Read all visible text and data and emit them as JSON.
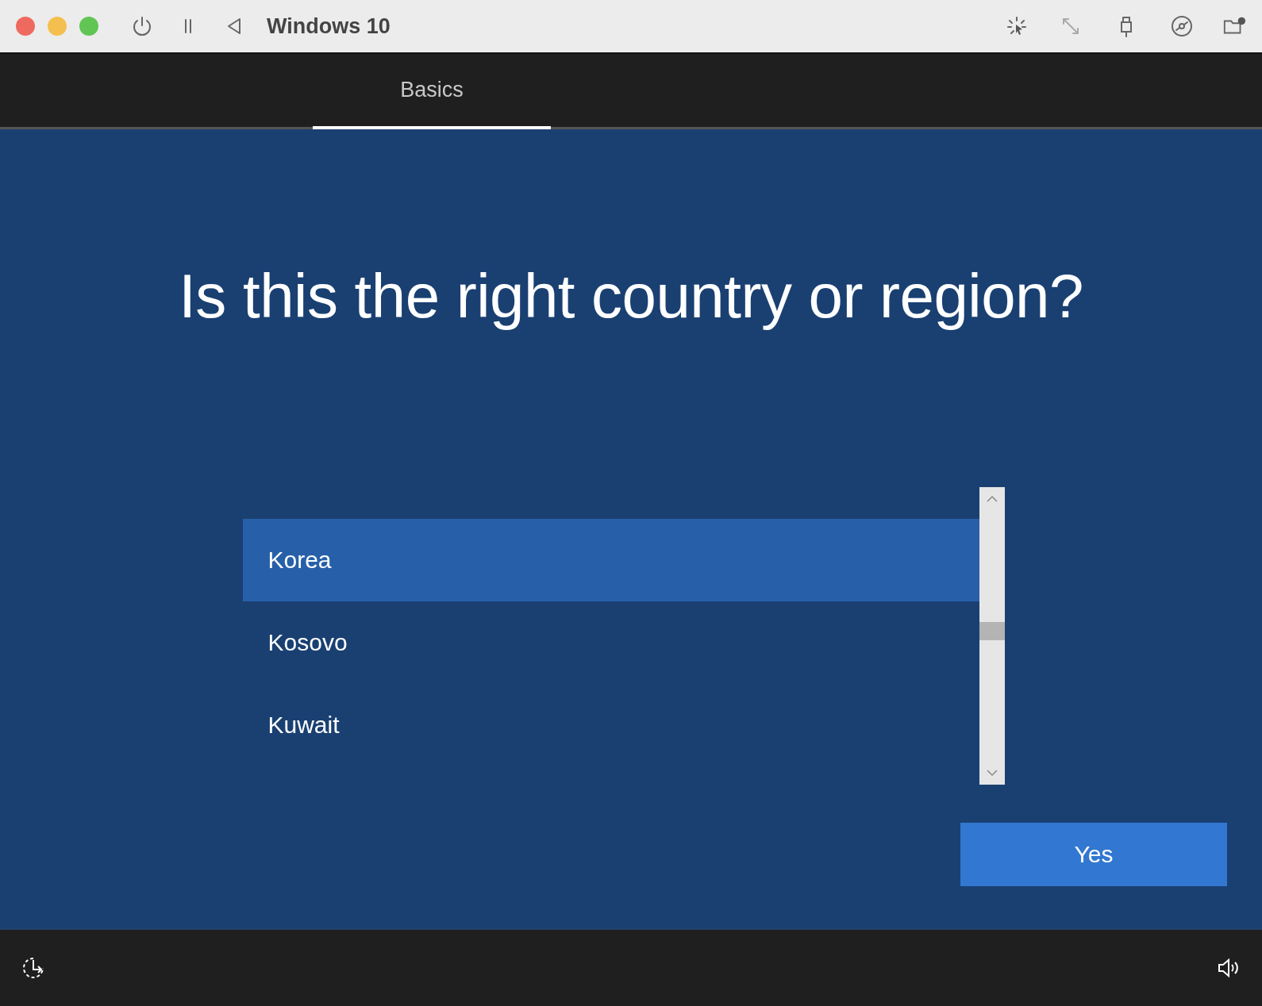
{
  "window": {
    "title": "Windows 10"
  },
  "tabs": [
    {
      "label": "Basics",
      "selected": true
    }
  ],
  "heading": "Is this the right country or region?",
  "countries": [
    {
      "name": "Korea",
      "selected": true
    },
    {
      "name": "Kosovo",
      "selected": false
    },
    {
      "name": "Kuwait",
      "selected": false
    }
  ],
  "confirm_button": "Yes"
}
